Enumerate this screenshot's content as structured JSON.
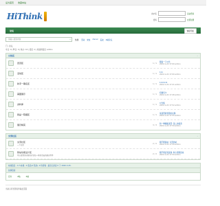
{
  "topbar": {
    "links": [
      "设为首页",
      "收藏本站"
    ]
  },
  "logo": {
    "text": "HiThink",
    "tagline": "Innovation · Wisdom · Technology"
  },
  "login": {
    "user_label": "用户名",
    "pass_label": "密码",
    "remember": "自动登录",
    "register": "立即注册"
  },
  "nav": {
    "home": "论坛",
    "mobile": "快捷导航"
  },
  "search": {
    "placeholder": "请输入搜索内容",
    "hot_label": "热搜:",
    "hot": [
      "活动",
      "交友",
      "discuz",
      "美女",
      "Z站论坛"
    ]
  },
  "crumb": "门 › 论坛",
  "stats": "今日: 0 | 昨日: 0 | 帖子: 10 | 会员: 2 | 欢迎新会员: admin",
  "section1": {
    "title": "公告区",
    "forums": [
      {
        "name": "置顶区",
        "count": "1 / 1",
        "last_title": "我发一下公告",
        "last_date": "2022-1-22 17:00 admin"
      },
      {
        "name": "活动区",
        "count": "1 / 1",
        "last_title": "111",
        "last_date": "2022-1-22 17:00 admin"
      },
      {
        "name": "新手一期名区",
        "count": "1 / 1",
        "last_title": "1111111",
        "last_date": "2022-1-22 17:41 admin"
      },
      {
        "name": "美图展示",
        "count": "1 / 1",
        "last_title": "有图有卡",
        "last_date": "2022-1-22 17:48 admin"
      },
      {
        "name": "资料库",
        "count": "1 / 1",
        "last_title": "公告板",
        "last_date": "2022-1-22 17:52 admin"
      },
      {
        "name": "我是一碗烟区",
        "count": "1 / 1",
        "last_title": "试试回复里面的主题",
        "last_date": "2022-1-22 17:55 admin"
      },
      {
        "name": "展示精英",
        "count": "3 / 3",
        "last_title": "新一季图集奖回: 第二次投票",
        "last_date": "2022-1-22 17:59 admin"
      }
    ]
  },
  "section2": {
    "title": "交流社区",
    "forums": [
      {
        "name": "交流社区",
        "desc": "一个社区",
        "count": "2 / 2",
        "last_title": "我不能发帖, 今天的帖",
        "last_date": "2022-1-22 17:59 admin"
      },
      {
        "name": "整站功能设计区",
        "desc": "可以发置顶功能的讨论和一些新论坛的建议等等",
        "count": "2 / 2",
        "last_title": "我不想去到美容, 但心里愿意来",
        "last_date": "2022-1-22 17:59 admin"
      }
    ]
  },
  "online": "在线会员 - 0 人在线 - 0 会员(0 隐身), 0 位游客 - 最高记录是 0 于 2020-3-25.",
  "friends": {
    "title": "友情链接",
    "links": [
      "官方",
      "Z站",
      "Z站"
    ]
  },
  "footer": "当前只有管理者查看此页面"
}
